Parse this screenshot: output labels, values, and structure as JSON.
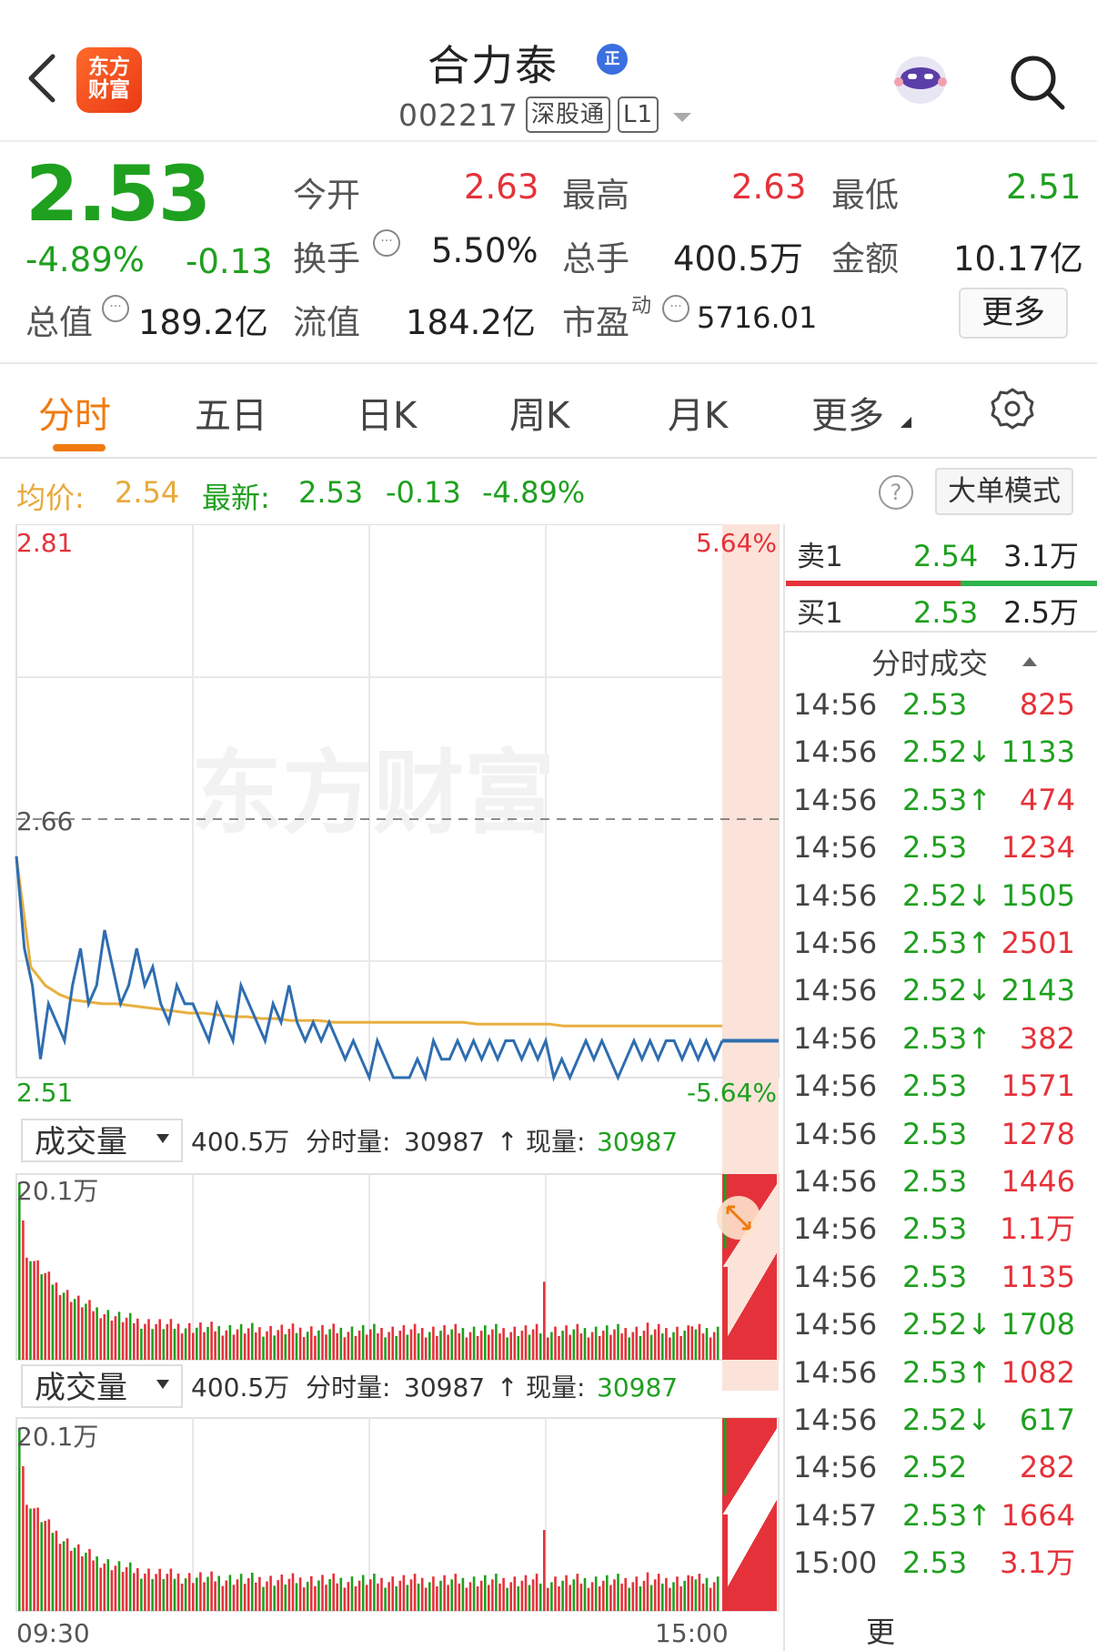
{
  "header": {
    "logo_text_1": "东方",
    "logo_text_2": "财富",
    "stock_name": "合力泰",
    "cert_badge": "正",
    "stock_code": "002217",
    "tag_connect": "深股通",
    "tag_level": "L1"
  },
  "quote": {
    "price": "2.53",
    "change_pct": "-4.89%",
    "change": "-0.13",
    "open_label": "今开",
    "open": "2.63",
    "high_label": "最高",
    "high": "2.63",
    "low_label": "最低",
    "low": "2.51",
    "turnover_label": "换手",
    "turnover": "5.50%",
    "volume_label": "总手",
    "volume": "400.5万",
    "amount_label": "金额",
    "amount": "10.17亿",
    "mktcap_label": "总值",
    "mktcap": "189.2亿",
    "float_label": "流值",
    "float_cap": "184.2亿",
    "pe_label": "市盈",
    "pe_sup": "动",
    "pe": "5716.01",
    "more_button": "更多"
  },
  "tabs": [
    {
      "label": "分时"
    },
    {
      "label": "五日"
    },
    {
      "label": "日K"
    },
    {
      "label": "周K"
    },
    {
      "label": "月K"
    },
    {
      "label": "更多"
    }
  ],
  "infobar": {
    "avg_label": "均价:",
    "avg": "2.54",
    "latest_label": "最新:",
    "latest": "2.53",
    "chg": "-0.13",
    "chg_pct": "-4.89%",
    "bigorder_button": "大单模式"
  },
  "chart_data": {
    "type": "line",
    "y_top_label": "2.81",
    "y_mid_label": "2.66",
    "y_bottom_label": "2.51",
    "pct_top_label": "5.64%",
    "pct_bottom_label": "-5.64%",
    "ylim": [
      2.51,
      2.81
    ],
    "prev_close": 2.66,
    "watermark": "东方财富",
    "price_series": [
      2.63,
      2.58,
      2.56,
      2.52,
      2.55,
      2.54,
      2.53,
      2.56,
      2.58,
      2.55,
      2.56,
      2.59,
      2.57,
      2.55,
      2.56,
      2.58,
      2.56,
      2.57,
      2.55,
      2.54,
      2.56,
      2.55,
      2.55,
      2.54,
      2.53,
      2.55,
      2.54,
      2.53,
      2.56,
      2.55,
      2.54,
      2.53,
      2.55,
      2.54,
      2.56,
      2.54,
      2.53,
      2.54,
      2.53,
      2.54,
      2.53,
      2.52,
      2.53,
      2.52,
      2.51,
      2.53,
      2.52,
      2.51,
      2.51,
      2.51,
      2.52,
      2.51,
      2.53,
      2.52,
      2.52,
      2.53,
      2.52,
      2.53,
      2.52,
      2.53,
      2.52,
      2.53,
      2.53,
      2.52,
      2.53,
      2.52,
      2.53,
      2.51,
      2.52,
      2.51,
      2.52,
      2.53,
      2.52,
      2.53,
      2.52,
      2.51,
      2.52,
      2.53,
      2.52,
      2.53,
      2.52,
      2.53,
      2.53,
      2.52,
      2.53,
      2.52,
      2.53,
      2.52,
      2.53
    ],
    "avg_series": [
      2.63,
      2.57,
      2.56,
      2.555,
      2.552,
      2.551,
      2.55,
      2.55,
      2.549,
      2.548,
      2.547,
      2.546,
      2.545,
      2.545,
      2.544,
      2.543,
      2.543,
      2.542,
      2.542,
      2.541,
      2.541,
      2.541,
      2.54,
      2.54,
      2.54,
      2.54,
      2.54,
      2.54,
      2.54,
      2.54,
      2.54,
      2.54,
      2.539,
      2.539,
      2.539,
      2.539,
      2.539,
      2.539,
      2.538,
      2.538,
      2.538,
      2.538,
      2.538,
      2.538,
      2.538,
      2.538,
      2.538,
      2.538,
      2.538,
      2.538
    ],
    "volume_panel_1": {
      "selector": "成交量",
      "total": "400.5万",
      "minute_label": "分时量:",
      "minute_vol": "30987",
      "current_label": "现量:",
      "current_vol": "30987",
      "max_label": "20.1万"
    },
    "volume_panel_2": {
      "selector": "成交量",
      "total": "400.5万",
      "minute_label": "分时量:",
      "minute_vol": "30987",
      "current_label": "现量:",
      "current_vol": "30987",
      "max_label": "20.1万"
    },
    "x_start": "09:30",
    "x_end": "15:00"
  },
  "orderbook": {
    "sell1_label": "卖1",
    "sell1_price": "2.54",
    "sell1_vol": "3.1万",
    "buy1_label": "买1",
    "buy1_price": "2.53",
    "buy1_vol": "2.5万",
    "ticks_header": "分时成交",
    "more_label": "更"
  },
  "ticks": [
    {
      "time": "14:56",
      "price": "2.53",
      "arrow": "",
      "vol": "825",
      "color": "red"
    },
    {
      "time": "14:56",
      "price": "2.52",
      "arrow": "↓",
      "vol": "1133",
      "color": "green"
    },
    {
      "time": "14:56",
      "price": "2.53",
      "arrow": "↑",
      "vol": "474",
      "color": "red"
    },
    {
      "time": "14:56",
      "price": "2.53",
      "arrow": "",
      "vol": "1234",
      "color": "red"
    },
    {
      "time": "14:56",
      "price": "2.52",
      "arrow": "↓",
      "vol": "1505",
      "color": "green"
    },
    {
      "time": "14:56",
      "price": "2.53",
      "arrow": "↑",
      "vol": "2501",
      "color": "red"
    },
    {
      "time": "14:56",
      "price": "2.52",
      "arrow": "↓",
      "vol": "2143",
      "color": "green"
    },
    {
      "time": "14:56",
      "price": "2.53",
      "arrow": "↑",
      "vol": "382",
      "color": "red"
    },
    {
      "time": "14:56",
      "price": "2.53",
      "arrow": "",
      "vol": "1571",
      "color": "red"
    },
    {
      "time": "14:56",
      "price": "2.53",
      "arrow": "",
      "vol": "1278",
      "color": "red"
    },
    {
      "time": "14:56",
      "price": "2.53",
      "arrow": "",
      "vol": "1446",
      "color": "red"
    },
    {
      "time": "14:56",
      "price": "2.53",
      "arrow": "",
      "vol": "1.1万",
      "color": "red"
    },
    {
      "time": "14:56",
      "price": "2.53",
      "arrow": "",
      "vol": "1135",
      "color": "red"
    },
    {
      "time": "14:56",
      "price": "2.52",
      "arrow": "↓",
      "vol": "1708",
      "color": "green"
    },
    {
      "time": "14:56",
      "price": "2.53",
      "arrow": "↑",
      "vol": "1082",
      "color": "red"
    },
    {
      "time": "14:56",
      "price": "2.52",
      "arrow": "↓",
      "vol": "617",
      "color": "green"
    },
    {
      "time": "14:56",
      "price": "2.52",
      "arrow": "",
      "vol": "282",
      "color": "red"
    },
    {
      "time": "14:57",
      "price": "2.53",
      "arrow": "↑",
      "vol": "1664",
      "color": "red"
    },
    {
      "time": "15:00",
      "price": "2.53",
      "arrow": "",
      "vol": "3.1万",
      "color": "red"
    }
  ],
  "colors": {
    "up": "#e5323a",
    "down": "#1fa01f",
    "avg": "#e8b040",
    "price": "#2f6db0",
    "accent": "#f07a10"
  }
}
